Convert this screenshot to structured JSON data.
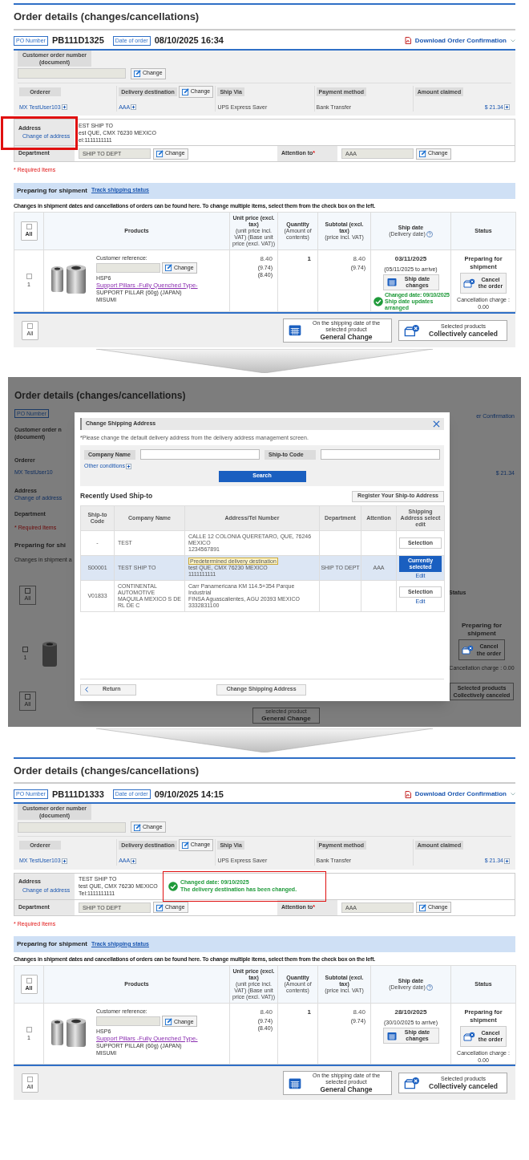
{
  "steps": [
    {
      "kind": "order",
      "title": "Order details (changes/cancellations)",
      "po_label": "PO Number",
      "po_number": "PB111D1325",
      "date_label": "Date of order",
      "date": "08/10/2025 16:34",
      "download": "Download Order Confirmation",
      "customer_order_label": "Customer order number (document)",
      "customer_order_change": "Change",
      "info": [
        {
          "label": "Orderer",
          "value": "MX TestUser103",
          "kind": "link"
        },
        {
          "label": "Delivery destination",
          "value": "AAA",
          "kind": "link",
          "change": "Change"
        },
        {
          "label": "Ship Via",
          "value": "UPS Express Saver",
          "kind": "text"
        },
        {
          "label": "Payment method",
          "value": "Bank Transfer",
          "kind": "text"
        },
        {
          "label": "Amount claimed",
          "value": "$ 21.34",
          "kind": "amount"
        }
      ],
      "address_label": "Address",
      "address_link": "Change of address",
      "address_highlighted": true,
      "address_lines": [
        "EST SHIP TO",
        "est QUE, CMX 76230 MEXICO",
        "el:1111111111"
      ],
      "department_label": "Department",
      "department": "SHIP TO DEPT",
      "department_change": "Change",
      "attention_label": "Attention to",
      "required_mark": "*",
      "attention": "AAA",
      "attention_change": "Change",
      "required_note": "* Required Items",
      "status_heading": "Preparing for shipment",
      "track_link": "Track shipping status",
      "note": "Changes in shipment dates and cancellations of orders can be found here. To change multiple items, select them from the check box on the left.",
      "select_all": {
        "label": "All",
        "checked": false
      },
      "columns": [
        {
          "title": "Products"
        },
        {
          "title": "Unit price (excl. tax)",
          "subtitle": "(unit price incl. VAT) (Base unit price (excl. VAT))"
        },
        {
          "title": "Quantity",
          "subtitle": "(Amount of contents)"
        },
        {
          "title": "Subtotal (excl. tax)",
          "subtitle": "(price incl. VAT)"
        },
        {
          "title": "Ship date",
          "subtitle": "(Delivery date)"
        },
        {
          "title": "Status"
        }
      ],
      "items": [
        {
          "checked": false,
          "index": "1",
          "ref_label": "Customer reference:",
          "ref_change": "Change",
          "code": "HSP6",
          "name": "Support Pillars -Fully Quenched Type-",
          "desc": "SUPPORT PILLAR (60g) (JAPAN)",
          "brand": "MISUMI",
          "unit_price": "8.40",
          "unit_price_vat": "(9.74)",
          "base_price": "(8.40)",
          "quantity": "1",
          "subtotal": "8.40",
          "subtotal_vat": "(9.74)",
          "ship_date": "03/11/2025",
          "arrive": "(05/11/2025 to arrive)",
          "ship_change": "Ship date changes",
          "ship_notice": {
            "date": "Changed date: 09/10/2025",
            "text": "Ship date updates arranged"
          },
          "status": "Preparing for shipment",
          "cancel": "Cancel the order",
          "cancel_charge": "Cancellation charge : 0.00"
        }
      ],
      "footer": {
        "select_all": {
          "label": "All",
          "checked": false
        },
        "general_top": "On the shipping date of the selected product",
        "general": "General Change",
        "collective_top": "Selected products",
        "collective": "Collectively canceled"
      }
    },
    {
      "kind": "dialog",
      "background": {
        "title": "Order details (changes/cancellations)",
        "left": [
          {
            "kind": "chip",
            "text": "PO Number"
          },
          {
            "kind": "label",
            "text": "Customer order n"
          },
          {
            "kind": "label",
            "text": "(document)"
          },
          {
            "kind": "label",
            "text": "Orderer"
          },
          {
            "kind": "link",
            "text": "MX TestUser10"
          },
          {
            "kind": "label",
            "text": "Address"
          },
          {
            "kind": "link",
            "text": "Change of address"
          },
          {
            "kind": "label",
            "text": "Department"
          },
          {
            "kind": "required",
            "text": "* Required Items"
          },
          {
            "kind": "heading",
            "text": "Preparing for shi"
          },
          {
            "kind": "note",
            "text": "Changes in shipment a"
          },
          {
            "kind": "checkbox",
            "text": "All",
            "checked": false
          },
          {
            "kind": "product",
            "text": "1",
            "checked": false
          },
          {
            "kind": "checkbox",
            "text": "All",
            "checked": false
          }
        ],
        "right": [
          {
            "kind": "link",
            "text": "er Confirmation"
          },
          {
            "kind": "link",
            "text": "$ 21.34"
          },
          {
            "kind": "label",
            "text": "Status"
          },
          {
            "kind": "heading",
            "text": "Preparing for shipment"
          },
          {
            "kind": "cancel",
            "text": "Cancel the order"
          },
          {
            "kind": "note",
            "text": "Cancellation charge : 0.00"
          },
          {
            "kind": "button",
            "text": "Selected products Collectively canceled"
          }
        ],
        "bottom": {
          "top": "selected product",
          "main": "General Change"
        }
      },
      "dialog": {
        "title": "Change Shipping Address",
        "note": "*Please change the default delivery address from the delivery address management screen.",
        "fields": [
          {
            "label": "Company Name"
          },
          {
            "label": "Ship-to Code"
          }
        ],
        "other_conditions": "Other conditions",
        "search": "Search",
        "recent_heading": "Recently Used Ship-to",
        "register": "Register Your Ship-to Address",
        "columns": [
          "Ship-to Code",
          "Company Name",
          "Address/Tel Number",
          "Department",
          "Attention",
          "Shipping Address select edit"
        ],
        "rows": [
          {
            "code": "-",
            "company": "TEST",
            "address_lines": [
              "CALLE 12 COLONIA QUERETARO, QUE, 76246",
              "MEXICO",
              "1234567891"
            ],
            "action": "Selection",
            "selected": false
          },
          {
            "code": "S00001",
            "company": "TEST SHIP TO",
            "tag": "Predetermined delivery destination",
            "address_lines": [
              "test QUE, CMX 76230 MEXICO",
              "1111111111"
            ],
            "department": "SHIP TO DEPT",
            "attention": "AAA",
            "action": "Currently selected",
            "edit": "Edit",
            "selected": true
          },
          {
            "code": "V01833",
            "company": "CONTINENTAL AUTOMOTIVE MAQUILA MEXICO S DE RL DE C",
            "address_lines": [
              "Carr Panamericana KM 114.5+354 Parque Industrial",
              "FINSA Aguascalientes, AGU 20393 MEXICO",
              "3332831100"
            ],
            "action": "Selection",
            "edit": "Edit",
            "selected": false
          }
        ],
        "return": "Return",
        "submit": "Change Shipping Address"
      }
    },
    {
      "kind": "order",
      "title": "Order details (changes/cancellations)",
      "po_label": "PO Number",
      "po_number": "PB111D1333",
      "date_label": "Date of order",
      "date": "09/10/2025 14:15",
      "download": "Download Order Confirmation",
      "customer_order_label": "Customer order number (document)",
      "customer_order_change": "Change",
      "info": [
        {
          "label": "Orderer",
          "value": "MX TestUser103",
          "kind": "link"
        },
        {
          "label": "Delivery destination",
          "value": "AAA",
          "kind": "link",
          "change": "Change"
        },
        {
          "label": "Ship Via",
          "value": "UPS Express Saver",
          "kind": "text"
        },
        {
          "label": "Payment method",
          "value": "Bank Transfer",
          "kind": "text"
        },
        {
          "label": "Amount claimed",
          "value": "$ 21.34",
          "kind": "amount"
        }
      ],
      "address_label": "Address",
      "address_link": "Change of address",
      "address_highlighted": false,
      "address_lines": [
        "TEST SHIP TO",
        "test QUE, CMX 76230 MEXICO",
        "Tel:1111111111"
      ],
      "address_notice": {
        "date": "Changed date: 09/10/2025",
        "text": "The delivery destination has been changed.",
        "highlighted": true
      },
      "department_label": "Department",
      "department": "SHIP TO DEPT",
      "department_change": "Change",
      "attention_label": "Attention to",
      "required_mark": "*",
      "attention": "AAA",
      "attention_change": "Change",
      "required_note": "* Required Items",
      "status_heading": "Preparing for shipment",
      "track_link": "Track shipping status",
      "note": "Changes in shipment dates and cancellations of orders can be found here. To change multiple items, select them from the check box on the left.",
      "select_all": {
        "label": "All",
        "checked": false
      },
      "columns": [
        {
          "title": "Products"
        },
        {
          "title": "Unit price (excl. tax)",
          "subtitle": "(unit price incl. VAT) (Base unit price (excl. VAT))"
        },
        {
          "title": "Quantity",
          "subtitle": "(Amount of contents)"
        },
        {
          "title": "Subtotal (excl. tax)",
          "subtitle": "(price incl. VAT)"
        },
        {
          "title": "Ship date",
          "subtitle": "(Delivery date)"
        },
        {
          "title": "Status"
        }
      ],
      "items": [
        {
          "checked": false,
          "index": "1",
          "ref_label": "Customer reference:",
          "ref_change": "Change",
          "code": "HSP6",
          "name": "Support Pillars -Fully Quenched Type-",
          "desc": "SUPPORT PILLAR (60g) (JAPAN)",
          "brand": "MISUMI",
          "unit_price": "8.40",
          "unit_price_vat": "(9.74)",
          "base_price": "(8.40)",
          "quantity": "1",
          "subtotal": "8.40",
          "subtotal_vat": "(9.74)",
          "ship_date": "28/10/2025",
          "arrive": "(30/10/2025 to arrive)",
          "ship_change": "Ship date changes",
          "status": "Preparing for shipment",
          "cancel": "Cancel the order",
          "cancel_charge": "Cancellation charge : 0.00"
        }
      ],
      "footer": {
        "select_all": {
          "label": "All",
          "checked": false
        },
        "general_top": "On the shipping date of the selected product",
        "general": "General Change",
        "collective_top": "Selected products",
        "collective": "Collectively canceled"
      }
    }
  ]
}
